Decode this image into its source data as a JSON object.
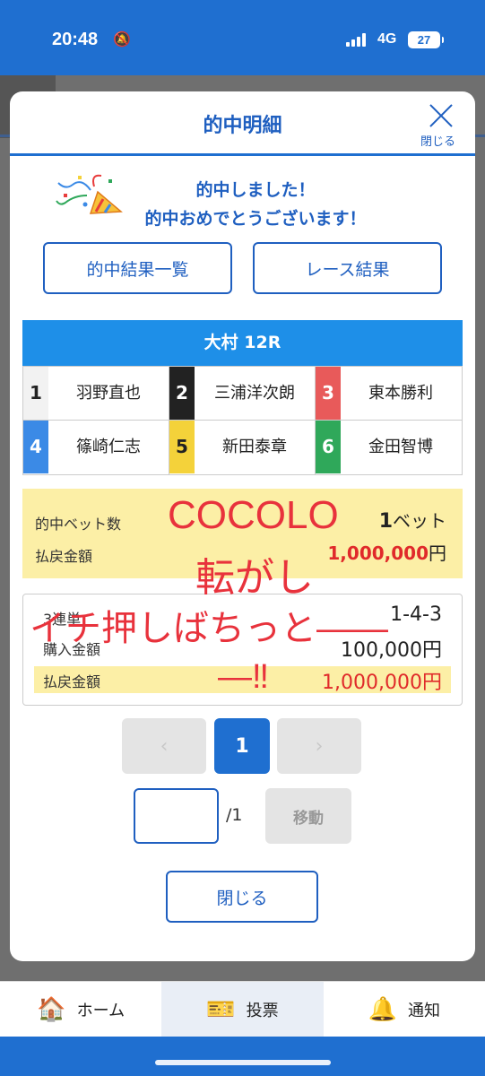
{
  "status_bar": {
    "time": "20:48",
    "network": "4G",
    "battery": "27"
  },
  "modal": {
    "title": "的中明細",
    "close_label": "閉じる",
    "congrats_line1": "的中しました！",
    "congrats_line2": "的中おめでとうございます！",
    "btn_hit_results": "的中結果一覧",
    "btn_race_results": "レース結果",
    "race": "大村 12R",
    "entries": [
      {
        "num": "1",
        "name": "羽野直也",
        "bg": "#ffffff",
        "fg": "#222222"
      },
      {
        "num": "2",
        "name": "三浦洋次朗",
        "bg": "#222222",
        "fg": "#ffffff"
      },
      {
        "num": "3",
        "name": "東本勝利",
        "bg": "#e85a5a",
        "fg": "#ffffff"
      },
      {
        "num": "4",
        "name": "篠崎仁志",
        "bg": "#3b8ae6",
        "fg": "#ffffff"
      },
      {
        "num": "5",
        "name": "新田泰章",
        "bg": "#f4d23a",
        "fg": "#222222"
      },
      {
        "num": "6",
        "name": "金田智博",
        "bg": "#2fa85a",
        "fg": "#ffffff"
      }
    ],
    "summary": {
      "bets_label": "的中ベット数",
      "bets_count": "1",
      "bets_unit": "ベット",
      "payout_label": "払戻金額",
      "payout_value": "1,000,000",
      "payout_unit": "円"
    },
    "detail": {
      "bet_type": "3連単",
      "combination": "1-4-3",
      "purchase_label": "購入金額",
      "purchase_value": "100,000円",
      "payout_label": "払戻金額",
      "payout_value": "1,000,000円"
    },
    "overlay": {
      "line1": "COCOLO",
      "line2": "転がし",
      "line3": "イチ押しばちっと――",
      "line4": "―‼"
    },
    "pagination": {
      "prev": "‹",
      "current": "1",
      "next": "›",
      "total": "/1",
      "go_label": "移動"
    },
    "close_button": "閉じる"
  },
  "bottom_nav": [
    {
      "label": "ホーム",
      "icon": "home-icon"
    },
    {
      "label": "投票",
      "icon": "ticket-icon"
    },
    {
      "label": "通知",
      "icon": "bell-icon"
    }
  ],
  "colors": {
    "brand": "#1f6fd0",
    "accent_red": "#e02a2a",
    "highlight": "#fcefa6"
  }
}
